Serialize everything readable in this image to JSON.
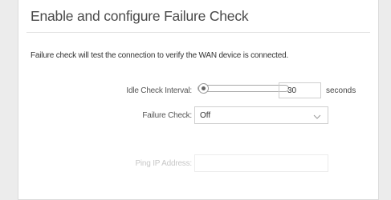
{
  "section": {
    "title": "Enable and configure Failure Check",
    "description": "Failure check will test the connection to verify the WAN device is connected."
  },
  "idle_check": {
    "label": "Idle Check Interval:",
    "value": "30",
    "unit": "seconds",
    "slider_level": 0
  },
  "failure_check": {
    "label": "Failure Check:",
    "selected": "Off"
  },
  "ping": {
    "label": "Ping IP Address:",
    "value": ""
  }
}
